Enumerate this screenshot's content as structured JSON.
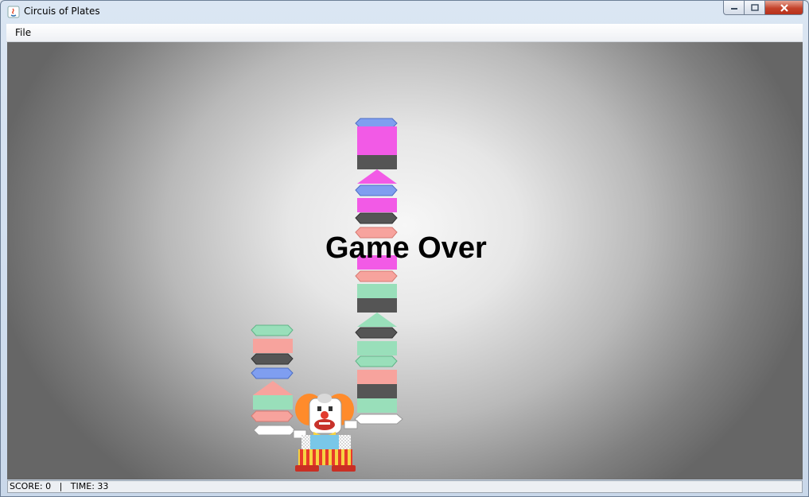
{
  "window": {
    "title": "Circuis of Plates"
  },
  "menu": {
    "items": [
      "File"
    ]
  },
  "game": {
    "message": "Game Over",
    "colors": {
      "blue": "#7f9ef0",
      "magenta": "#f25ae6",
      "dark": "#555555",
      "salmon": "#f7a39d",
      "green": "#99dfba",
      "white": "#ffffff"
    }
  },
  "status": {
    "text": "SCORE: 0   |   TIME: 33"
  }
}
